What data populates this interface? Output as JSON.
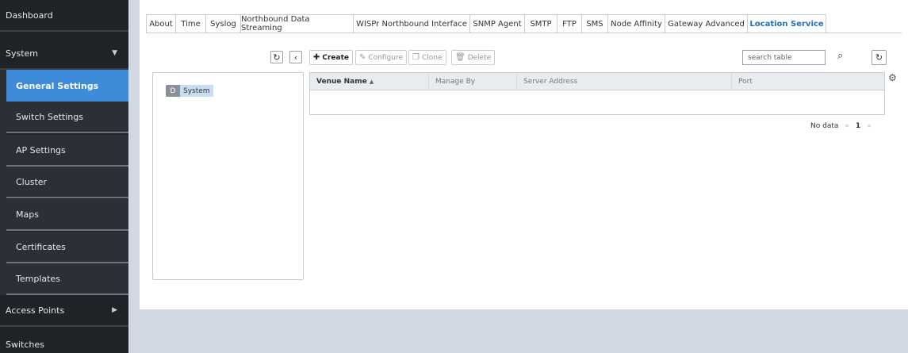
{
  "sidebar": {
    "top_items": [
      {
        "label": "Dashboard"
      },
      {
        "label": "System"
      },
      {
        "label": "Access Points"
      },
      {
        "label": "Switches"
      }
    ],
    "system_sub_items": [
      {
        "label": "General Settings"
      },
      {
        "label": "Switch Settings"
      },
      {
        "label": "AP Settings"
      },
      {
        "label": "Cluster"
      },
      {
        "label": "Maps"
      },
      {
        "label": "Certificates"
      },
      {
        "label": "Templates"
      }
    ],
    "active_sub_item": "General Settings"
  },
  "tabs": [
    "About",
    "Time",
    "Syslog",
    "Northbound Data Streaming",
    "WISPr Northbound Interface",
    "SNMP Agent",
    "SMTP",
    "FTP",
    "SMS",
    "Node Affinity",
    "Gateway Advanced",
    "Location Service"
  ],
  "active_tab": "Location Service",
  "toolbar": {
    "create_label": "Create",
    "configure_label": "Configure",
    "clone_label": "Clone",
    "delete_label": "Delete"
  },
  "search": {
    "placeholder": "search table"
  },
  "tree": {
    "badge": "D",
    "label": "System"
  },
  "table": {
    "columns": [
      "Venue Name",
      "Manage By",
      "Server Address",
      "Port"
    ],
    "sort_indicator": "▲",
    "rows": []
  },
  "pager": {
    "status": "No data",
    "page": "1",
    "prev": "«",
    "next": "»"
  },
  "colors": {
    "accent": "#3d8bd9",
    "active_tab_text": "#1f6fbf",
    "sidebar_bg": "#1f2328"
  }
}
